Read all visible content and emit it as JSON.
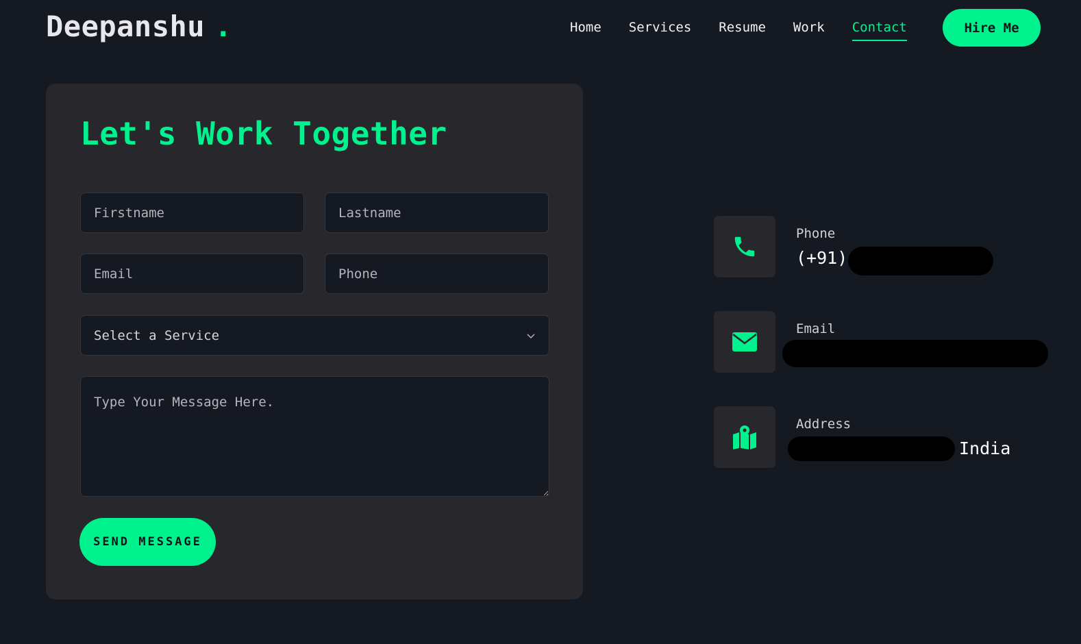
{
  "brand": {
    "name": "Deepanshu",
    "dot": "."
  },
  "nav": {
    "items": [
      {
        "label": "Home"
      },
      {
        "label": "Services"
      },
      {
        "label": "Resume"
      },
      {
        "label": "Work"
      },
      {
        "label": "Contact",
        "active": true
      }
    ],
    "hire_label": "Hire Me"
  },
  "form": {
    "title": "Let's Work Together",
    "firstname_placeholder": "Firstname",
    "lastname_placeholder": "Lastname",
    "email_placeholder": "Email",
    "phone_placeholder": "Phone",
    "service_placeholder": "Select a Service",
    "message_placeholder": "Type Your Message Here.",
    "send_label": "SEND MESSAGE"
  },
  "contact_info": {
    "phone": {
      "label": "Phone",
      "value": "(+91)",
      "icon": "phone-icon"
    },
    "email": {
      "label": "Email",
      "value": "",
      "icon": "envelope-icon"
    },
    "address": {
      "label": "Address",
      "value": "India",
      "icon": "map-pin-icon"
    }
  },
  "colors": {
    "accent": "#00f28f",
    "background": "#151922",
    "card": "#27272c"
  }
}
